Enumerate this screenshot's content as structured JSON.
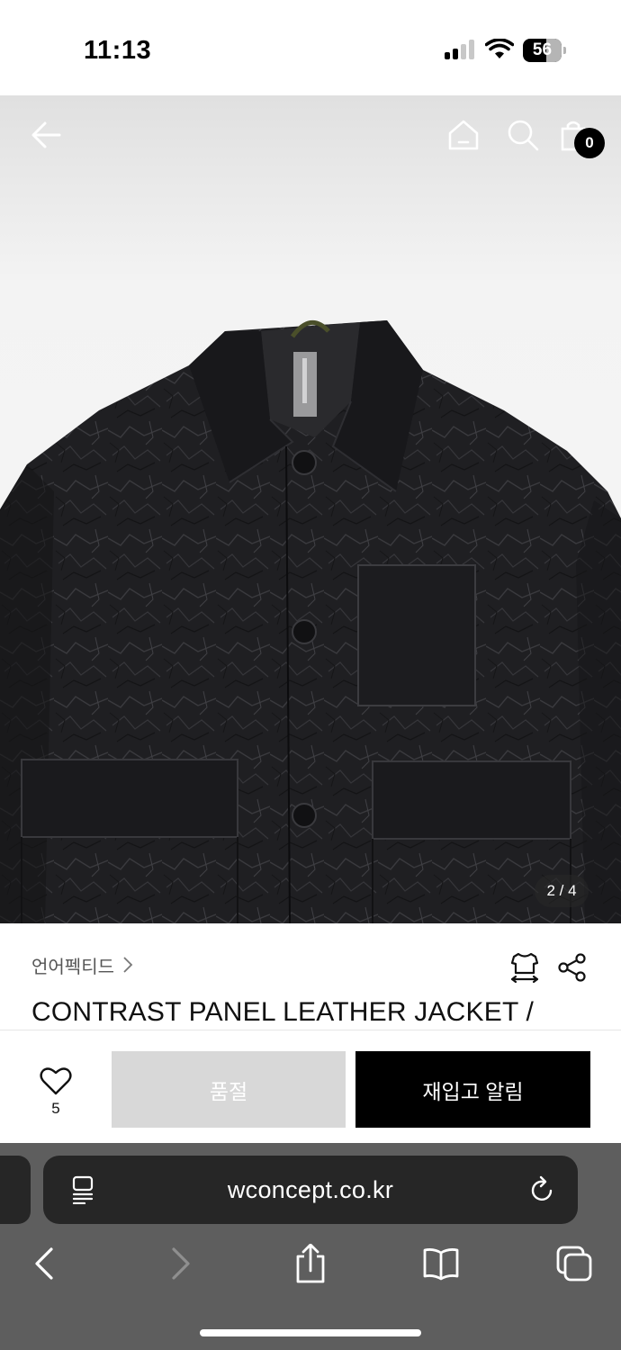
{
  "status_bar": {
    "time": "11:13",
    "battery_level": "56"
  },
  "product_image": {
    "counter": "2 / 4",
    "cart_count": "0"
  },
  "product": {
    "brand": "언어펙티드",
    "title": "CONTRAST PANEL LEATHER JACKET /"
  },
  "actions": {
    "like_count": "5",
    "soldout_label": "품절",
    "restock_label": "재입고 알림"
  },
  "browser": {
    "url": "wconcept.co.kr"
  },
  "colors": {
    "primary_button": "#000000",
    "disabled_button": "#d8d8d8",
    "safari_toolbar": "#5e5e5e",
    "url_bar": "#262626"
  },
  "icons": [
    "back-arrow-icon",
    "home-icon",
    "search-icon",
    "shopping-bag-icon",
    "chevron-right-icon",
    "size-guide-icon",
    "share-icon",
    "heart-icon",
    "reader-icon",
    "reload-icon",
    "browser-back-icon",
    "browser-forward-icon",
    "share-up-icon",
    "bookmarks-icon",
    "tabs-icon"
  ]
}
